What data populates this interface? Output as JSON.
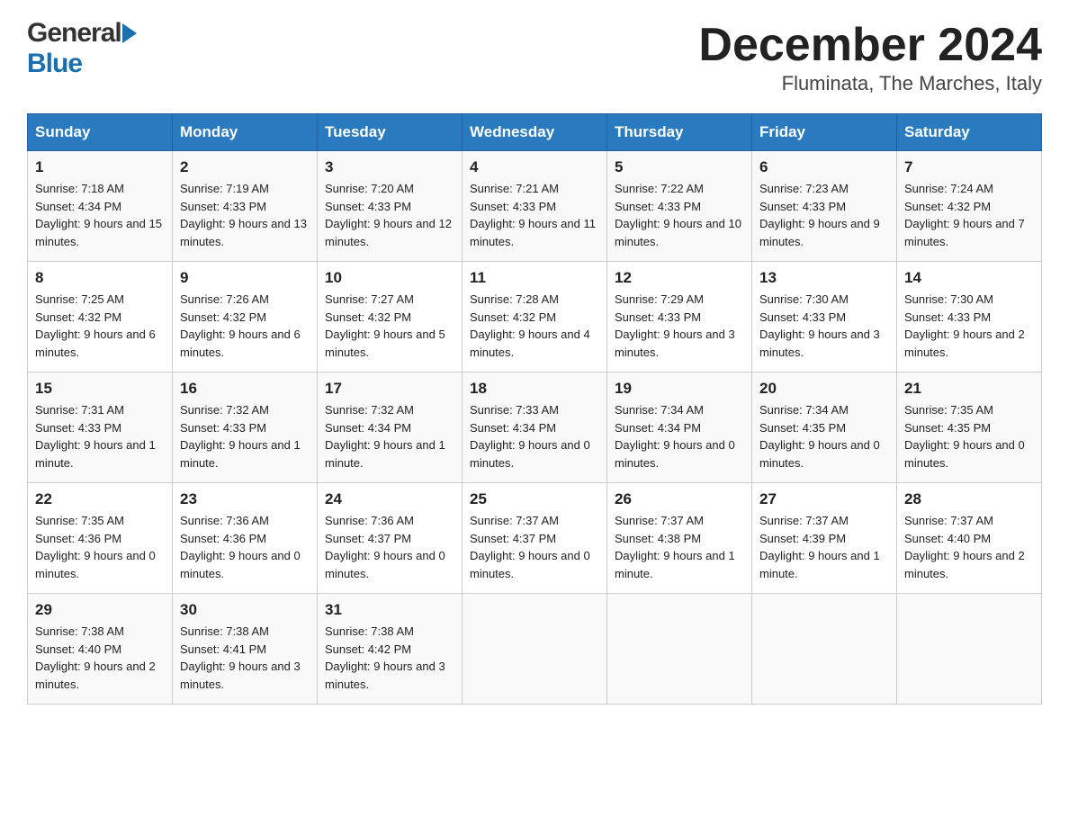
{
  "logo": {
    "general": "General",
    "blue": "Blue"
  },
  "title": "December 2024",
  "subtitle": "Fluminata, The Marches, Italy",
  "days": [
    "Sunday",
    "Monday",
    "Tuesday",
    "Wednesday",
    "Thursday",
    "Friday",
    "Saturday"
  ],
  "weeks": [
    [
      {
        "day": "1",
        "sunrise": "7:18 AM",
        "sunset": "4:34 PM",
        "daylight": "9 hours and 15 minutes."
      },
      {
        "day": "2",
        "sunrise": "7:19 AM",
        "sunset": "4:33 PM",
        "daylight": "9 hours and 13 minutes."
      },
      {
        "day": "3",
        "sunrise": "7:20 AM",
        "sunset": "4:33 PM",
        "daylight": "9 hours and 12 minutes."
      },
      {
        "day": "4",
        "sunrise": "7:21 AM",
        "sunset": "4:33 PM",
        "daylight": "9 hours and 11 minutes."
      },
      {
        "day": "5",
        "sunrise": "7:22 AM",
        "sunset": "4:33 PM",
        "daylight": "9 hours and 10 minutes."
      },
      {
        "day": "6",
        "sunrise": "7:23 AM",
        "sunset": "4:33 PM",
        "daylight": "9 hours and 9 minutes."
      },
      {
        "day": "7",
        "sunrise": "7:24 AM",
        "sunset": "4:32 PM",
        "daylight": "9 hours and 7 minutes."
      }
    ],
    [
      {
        "day": "8",
        "sunrise": "7:25 AM",
        "sunset": "4:32 PM",
        "daylight": "9 hours and 6 minutes."
      },
      {
        "day": "9",
        "sunrise": "7:26 AM",
        "sunset": "4:32 PM",
        "daylight": "9 hours and 6 minutes."
      },
      {
        "day": "10",
        "sunrise": "7:27 AM",
        "sunset": "4:32 PM",
        "daylight": "9 hours and 5 minutes."
      },
      {
        "day": "11",
        "sunrise": "7:28 AM",
        "sunset": "4:32 PM",
        "daylight": "9 hours and 4 minutes."
      },
      {
        "day": "12",
        "sunrise": "7:29 AM",
        "sunset": "4:33 PM",
        "daylight": "9 hours and 3 minutes."
      },
      {
        "day": "13",
        "sunrise": "7:30 AM",
        "sunset": "4:33 PM",
        "daylight": "9 hours and 3 minutes."
      },
      {
        "day": "14",
        "sunrise": "7:30 AM",
        "sunset": "4:33 PM",
        "daylight": "9 hours and 2 minutes."
      }
    ],
    [
      {
        "day": "15",
        "sunrise": "7:31 AM",
        "sunset": "4:33 PM",
        "daylight": "9 hours and 1 minute."
      },
      {
        "day": "16",
        "sunrise": "7:32 AM",
        "sunset": "4:33 PM",
        "daylight": "9 hours and 1 minute."
      },
      {
        "day": "17",
        "sunrise": "7:32 AM",
        "sunset": "4:34 PM",
        "daylight": "9 hours and 1 minute."
      },
      {
        "day": "18",
        "sunrise": "7:33 AM",
        "sunset": "4:34 PM",
        "daylight": "9 hours and 0 minutes."
      },
      {
        "day": "19",
        "sunrise": "7:34 AM",
        "sunset": "4:34 PM",
        "daylight": "9 hours and 0 minutes."
      },
      {
        "day": "20",
        "sunrise": "7:34 AM",
        "sunset": "4:35 PM",
        "daylight": "9 hours and 0 minutes."
      },
      {
        "day": "21",
        "sunrise": "7:35 AM",
        "sunset": "4:35 PM",
        "daylight": "9 hours and 0 minutes."
      }
    ],
    [
      {
        "day": "22",
        "sunrise": "7:35 AM",
        "sunset": "4:36 PM",
        "daylight": "9 hours and 0 minutes."
      },
      {
        "day": "23",
        "sunrise": "7:36 AM",
        "sunset": "4:36 PM",
        "daylight": "9 hours and 0 minutes."
      },
      {
        "day": "24",
        "sunrise": "7:36 AM",
        "sunset": "4:37 PM",
        "daylight": "9 hours and 0 minutes."
      },
      {
        "day": "25",
        "sunrise": "7:37 AM",
        "sunset": "4:37 PM",
        "daylight": "9 hours and 0 minutes."
      },
      {
        "day": "26",
        "sunrise": "7:37 AM",
        "sunset": "4:38 PM",
        "daylight": "9 hours and 1 minute."
      },
      {
        "day": "27",
        "sunrise": "7:37 AM",
        "sunset": "4:39 PM",
        "daylight": "9 hours and 1 minute."
      },
      {
        "day": "28",
        "sunrise": "7:37 AM",
        "sunset": "4:40 PM",
        "daylight": "9 hours and 2 minutes."
      }
    ],
    [
      {
        "day": "29",
        "sunrise": "7:38 AM",
        "sunset": "4:40 PM",
        "daylight": "9 hours and 2 minutes."
      },
      {
        "day": "30",
        "sunrise": "7:38 AM",
        "sunset": "4:41 PM",
        "daylight": "9 hours and 3 minutes."
      },
      {
        "day": "31",
        "sunrise": "7:38 AM",
        "sunset": "4:42 PM",
        "daylight": "9 hours and 3 minutes."
      },
      null,
      null,
      null,
      null
    ]
  ],
  "labels": {
    "sunrise": "Sunrise:",
    "sunset": "Sunset:",
    "daylight": "Daylight:"
  }
}
